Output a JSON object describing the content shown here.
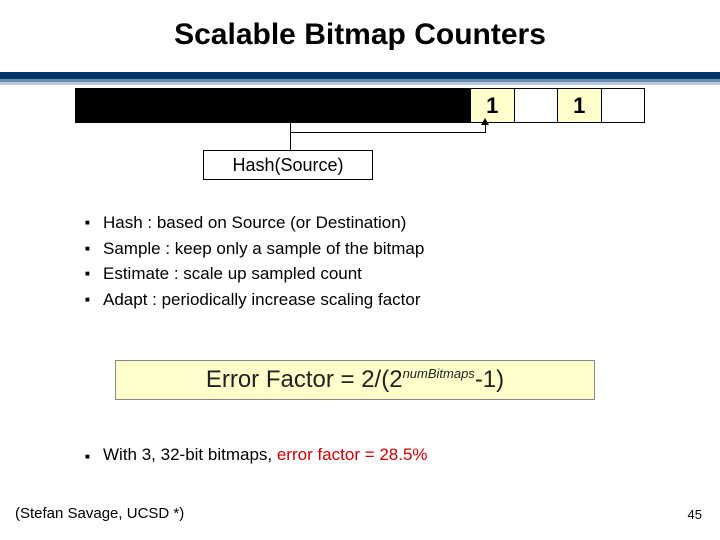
{
  "title": "Scalable Bitmap Counters",
  "bitmap": {
    "marks": [
      "1",
      "1"
    ]
  },
  "hash_label": "Hash(Source)",
  "bullets": [
    "Hash : based on Source (or Destination)",
    "Sample : keep only a sample of the bitmap",
    "Estimate : scale up sampled count",
    "Adapt : periodically increase scaling factor"
  ],
  "formula": {
    "prefix": "Error Factor = 2/(2",
    "sup": "numBitmaps",
    "suffix": "-1)"
  },
  "conclusion": {
    "pre": "With 3, 32-bit bitmaps, ",
    "red": "error factor = 28.5%"
  },
  "attribution": "(Stefan Savage, UCSD *)",
  "page": "45"
}
